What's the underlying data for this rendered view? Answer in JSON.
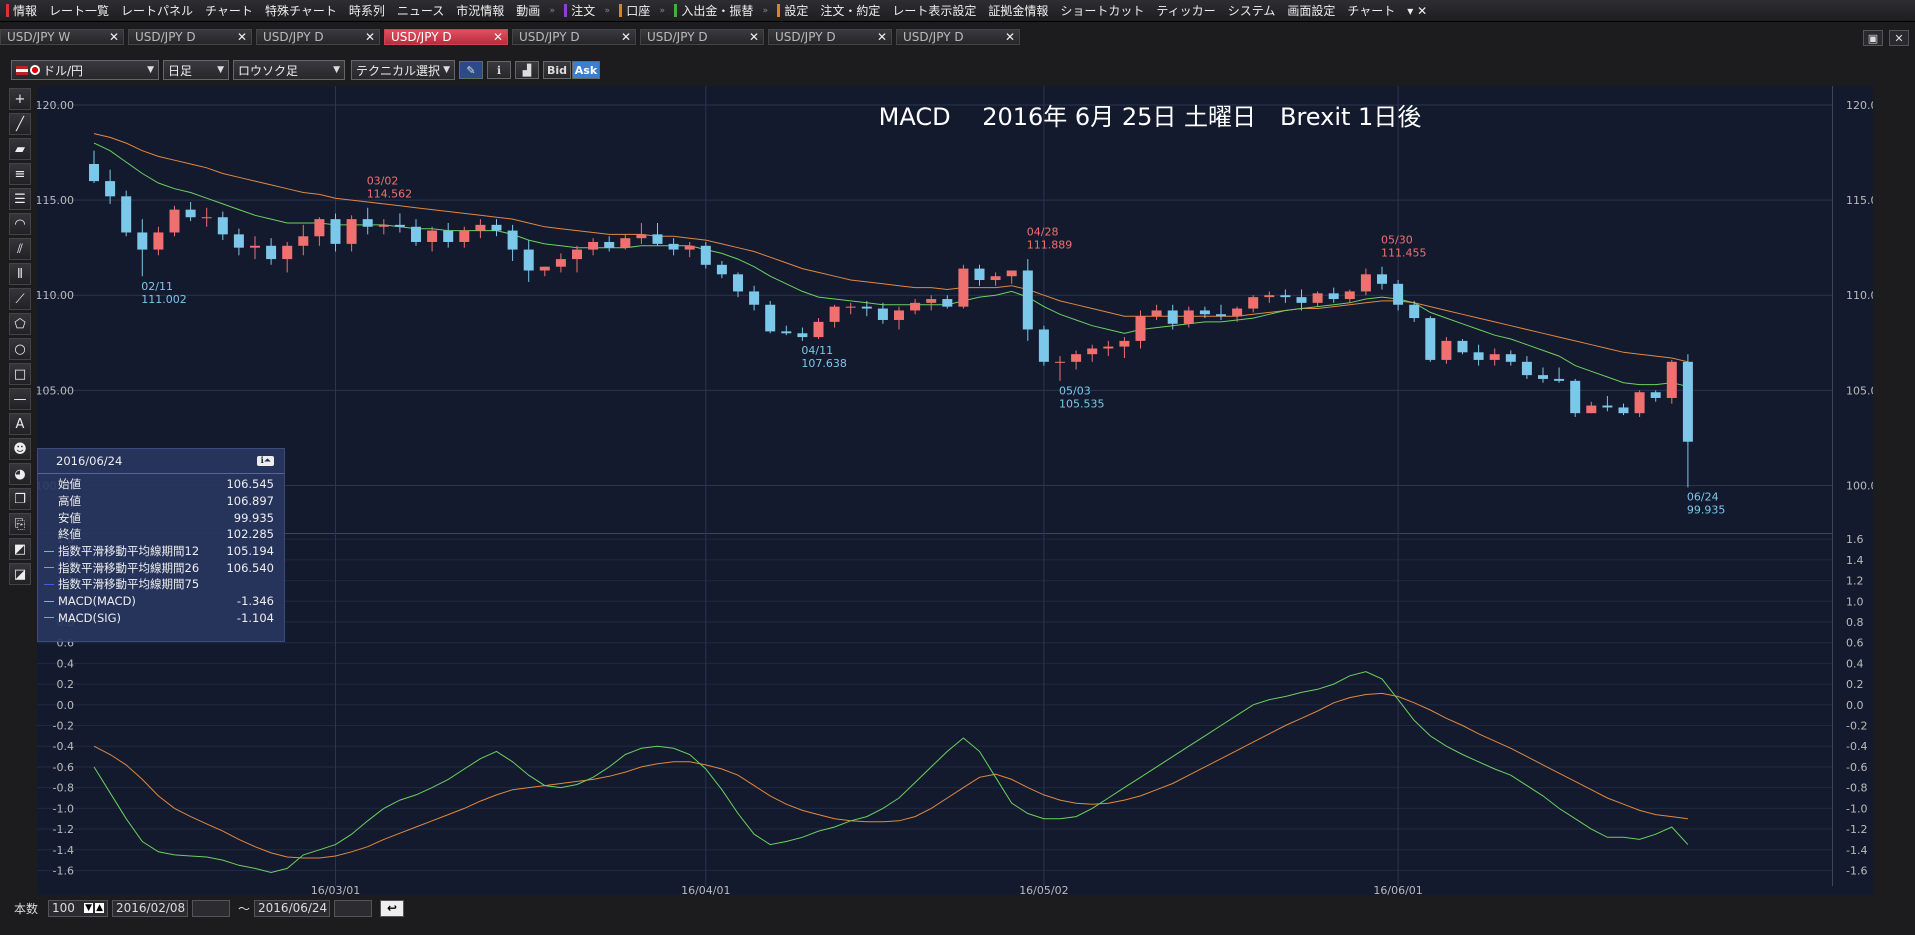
{
  "menu": {
    "items": [
      {
        "label": "情報",
        "color": "#e03030"
      },
      {
        "label": "レート一覧",
        "color": ""
      },
      {
        "label": "レートパネル",
        "color": ""
      },
      {
        "label": "チャート",
        "color": ""
      },
      {
        "label": "特殊チャート",
        "color": ""
      },
      {
        "label": "時系列",
        "color": ""
      },
      {
        "label": "ニュース",
        "color": ""
      },
      {
        "label": "市況情報",
        "color": ""
      },
      {
        "label": "動画",
        "color": ""
      },
      {
        "label": "注文",
        "color": "#9040d0"
      },
      {
        "label": "口座",
        "color": "#e08020"
      },
      {
        "label": "入出金・振替",
        "color": "#40b040"
      },
      {
        "label": "設定",
        "color": "#e08020"
      },
      {
        "label": "注文・約定",
        "color": ""
      },
      {
        "label": "レート表示設定",
        "color": ""
      },
      {
        "label": "証拠金情報",
        "color": ""
      },
      {
        "label": "ショートカット",
        "color": ""
      },
      {
        "label": "ティッカー",
        "color": ""
      },
      {
        "label": "システム",
        "color": ""
      },
      {
        "label": "画面設定",
        "color": ""
      },
      {
        "label": "チャート",
        "color": ""
      }
    ]
  },
  "tabs": [
    {
      "label": "USD/JPY W",
      "active": false
    },
    {
      "label": "USD/JPY D",
      "active": false
    },
    {
      "label": "USD/JPY D",
      "active": false
    },
    {
      "label": "USD/JPY D",
      "active": true
    },
    {
      "label": "USD/JPY D",
      "active": false
    },
    {
      "label": "USD/JPY D",
      "active": false
    },
    {
      "label": "USD/JPY D",
      "active": false
    },
    {
      "label": "USD/JPY D",
      "active": false
    }
  ],
  "toolbar": {
    "pair": "ドル/円",
    "period": "日足",
    "style": "ロウソク足",
    "technical": "テクニカル選択",
    "bid": "Bid",
    "ask": "Ask"
  },
  "chart_title": "MACD　 2016年 6月 25日 土曜日　Brexit 1日後",
  "info": {
    "date": "2016/06/24",
    "rows": [
      {
        "label": "始値",
        "value": "106.545",
        "color": ""
      },
      {
        "label": "高値",
        "value": "106.897",
        "color": ""
      },
      {
        "label": "安値",
        "value": "99.935",
        "color": ""
      },
      {
        "label": "終値",
        "value": "102.285",
        "color": ""
      },
      {
        "label": "指数平滑移動平均線期間12",
        "value": "105.194",
        "color": "#6cd060"
      },
      {
        "label": "指数平滑移動平均線期間26",
        "value": "106.540",
        "color": "#e08840"
      },
      {
        "label": "指数平滑移動平均線期間75",
        "value": "",
        "color": "#4060e0"
      },
      {
        "label": "MACD(MACD)",
        "value": "-1.346",
        "color": "#6cd060"
      },
      {
        "label": "MACD(SIG)",
        "value": "-1.104",
        "color": "#e08840"
      }
    ]
  },
  "bottom": {
    "count_label": "本数",
    "count": "100",
    "from": "2016/02/08",
    "tilde": "〜",
    "to": "2016/06/24"
  },
  "colors": {
    "up": "#f07070",
    "down": "#7cc8ea",
    "ema12": "#6cd060",
    "ema26": "#e08840",
    "bg": "#131a2d",
    "grid": "#2a3550"
  },
  "chart_data": {
    "type": "candlestick",
    "price_axis": {
      "min": 97.5,
      "max": 121,
      "ticks": [
        "120.00",
        "115.00",
        "110.00",
        "105.00",
        "100.00"
      ]
    },
    "macd_axis": {
      "min": -1.75,
      "max": 1.65,
      "ticks": [
        "1.6",
        "1.4",
        "1.2",
        "1.0",
        "0.8",
        "0.6",
        "0.4",
        "0.2",
        "0.0",
        "-0.2",
        "-0.4",
        "-0.6",
        "-0.8",
        "-1.0",
        "-1.2",
        "-1.4",
        "-1.6"
      ]
    },
    "x_labels": [
      {
        "label": "16/03/01",
        "index": 15
      },
      {
        "label": "16/04/01",
        "index": 38
      },
      {
        "label": "16/05/02",
        "index": 59
      },
      {
        "label": "16/06/01",
        "index": 81
      }
    ],
    "annotations": [
      {
        "date": "02/11",
        "value": "111.002",
        "index": 3,
        "price": 111.0,
        "color": "#7cc8ea",
        "pos": "below"
      },
      {
        "date": "03/02",
        "value": "114.562",
        "index": 17,
        "price": 114.56,
        "color": "#f07070",
        "pos": "above"
      },
      {
        "date": "04/11",
        "value": "107.638",
        "index": 44,
        "price": 107.64,
        "color": "#7cc8ea",
        "pos": "below"
      },
      {
        "date": "04/28",
        "value": "111.889",
        "index": 58,
        "price": 111.89,
        "color": "#f07070",
        "pos": "above"
      },
      {
        "date": "05/03",
        "value": "105.535",
        "index": 60,
        "price": 105.53,
        "color": "#7cc8ea",
        "pos": "below"
      },
      {
        "date": "05/30",
        "value": "111.455",
        "index": 80,
        "price": 111.46,
        "color": "#f07070",
        "pos": "above"
      },
      {
        "date": "06/24",
        "value": "99.935",
        "index": 99,
        "price": 99.94,
        "color": "#7cc8ea",
        "pos": "below"
      }
    ],
    "ohlc": [
      [
        116.9,
        117.6,
        115.9,
        116.0
      ],
      [
        116.0,
        116.6,
        114.8,
        115.2
      ],
      [
        115.2,
        115.5,
        113.1,
        113.3
      ],
      [
        113.3,
        114.0,
        111.0,
        112.4
      ],
      [
        112.4,
        113.6,
        112.1,
        113.3
      ],
      [
        113.3,
        114.7,
        113.1,
        114.5
      ],
      [
        114.5,
        114.9,
        113.9,
        114.1
      ],
      [
        114.1,
        114.6,
        113.6,
        114.1
      ],
      [
        114.1,
        114.4,
        112.9,
        113.2
      ],
      [
        113.2,
        113.5,
        112.1,
        112.5
      ],
      [
        112.5,
        113.1,
        111.9,
        112.6
      ],
      [
        112.6,
        113.0,
        111.6,
        111.9
      ],
      [
        111.9,
        112.8,
        111.2,
        112.6
      ],
      [
        112.6,
        113.7,
        112.1,
        113.1
      ],
      [
        113.1,
        114.1,
        112.6,
        114.0
      ],
      [
        114.0,
        114.3,
        112.3,
        112.7
      ],
      [
        112.7,
        114.2,
        112.3,
        114.0
      ],
      [
        114.0,
        114.6,
        113.2,
        113.6
      ],
      [
        113.6,
        114.0,
        113.2,
        113.7
      ],
      [
        113.7,
        114.3,
        113.3,
        113.6
      ],
      [
        113.6,
        114.0,
        112.6,
        112.8
      ],
      [
        112.8,
        113.6,
        112.3,
        113.4
      ],
      [
        113.4,
        113.8,
        112.5,
        112.8
      ],
      [
        112.8,
        113.6,
        112.5,
        113.4
      ],
      [
        113.4,
        114.0,
        113.0,
        113.7
      ],
      [
        113.7,
        114.0,
        113.1,
        113.4
      ],
      [
        113.4,
        113.7,
        111.8,
        112.4
      ],
      [
        112.4,
        112.9,
        110.7,
        111.3
      ],
      [
        111.3,
        111.5,
        111.0,
        111.5
      ],
      [
        111.5,
        112.2,
        111.2,
        111.9
      ],
      [
        111.9,
        112.6,
        111.2,
        112.4
      ],
      [
        112.4,
        113.0,
        112.1,
        112.8
      ],
      [
        112.8,
        113.1,
        112.3,
        112.5
      ],
      [
        112.5,
        113.2,
        112.4,
        113.0
      ],
      [
        113.0,
        113.8,
        112.7,
        113.2
      ],
      [
        113.2,
        113.8,
        112.6,
        112.7
      ],
      [
        112.7,
        113.0,
        112.1,
        112.4
      ],
      [
        112.4,
        112.8,
        112.0,
        112.6
      ],
      [
        112.6,
        112.8,
        111.4,
        111.6
      ],
      [
        111.6,
        111.8,
        110.9,
        111.1
      ],
      [
        111.1,
        111.2,
        109.9,
        110.2
      ],
      [
        110.2,
        110.5,
        109.2,
        109.5
      ],
      [
        109.5,
        109.7,
        108.0,
        108.1
      ],
      [
        108.1,
        108.4,
        107.9,
        108.0
      ],
      [
        108.0,
        108.3,
        107.6,
        107.8
      ],
      [
        107.8,
        108.8,
        107.7,
        108.6
      ],
      [
        108.6,
        109.5,
        108.3,
        109.4
      ],
      [
        109.4,
        109.6,
        109.0,
        109.4
      ],
      [
        109.4,
        109.7,
        108.9,
        109.3
      ],
      [
        109.3,
        109.6,
        108.5,
        108.7
      ],
      [
        108.7,
        109.4,
        108.2,
        109.2
      ],
      [
        109.2,
        109.8,
        109.0,
        109.6
      ],
      [
        109.6,
        110.0,
        109.2,
        109.8
      ],
      [
        109.8,
        110.0,
        109.3,
        109.4
      ],
      [
        109.4,
        111.6,
        109.3,
        111.4
      ],
      [
        111.4,
        111.6,
        110.5,
        110.8
      ],
      [
        110.8,
        111.2,
        110.5,
        111.0
      ],
      [
        111.0,
        111.3,
        110.6,
        111.3
      ],
      [
        111.3,
        111.9,
        107.6,
        108.2
      ],
      [
        108.2,
        108.4,
        106.3,
        106.5
      ],
      [
        106.5,
        106.8,
        105.5,
        106.5
      ],
      [
        106.5,
        107.1,
        106.1,
        106.9
      ],
      [
        106.9,
        107.4,
        106.5,
        107.2
      ],
      [
        107.2,
        107.6,
        106.8,
        107.3
      ],
      [
        107.3,
        107.8,
        106.7,
        107.6
      ],
      [
        107.6,
        109.2,
        107.2,
        108.9
      ],
      [
        108.9,
        109.5,
        108.7,
        109.2
      ],
      [
        109.2,
        109.5,
        108.2,
        108.5
      ],
      [
        108.5,
        109.4,
        108.3,
        109.2
      ],
      [
        109.2,
        109.4,
        108.8,
        109.0
      ],
      [
        109.0,
        109.5,
        108.7,
        108.9
      ],
      [
        108.9,
        109.4,
        108.6,
        109.3
      ],
      [
        109.3,
        110.0,
        109.1,
        109.9
      ],
      [
        109.9,
        110.2,
        109.6,
        110.0
      ],
      [
        110.0,
        110.3,
        109.6,
        109.9
      ],
      [
        109.9,
        110.3,
        109.2,
        109.6
      ],
      [
        109.6,
        110.2,
        109.4,
        110.1
      ],
      [
        110.1,
        110.4,
        109.6,
        109.8
      ],
      [
        109.8,
        110.3,
        109.6,
        110.2
      ],
      [
        110.2,
        111.4,
        110.0,
        111.1
      ],
      [
        111.1,
        111.5,
        110.3,
        110.6
      ],
      [
        110.6,
        110.8,
        109.2,
        109.5
      ],
      [
        109.5,
        109.7,
        108.6,
        108.8
      ],
      [
        108.8,
        108.9,
        106.5,
        106.6
      ],
      [
        106.6,
        107.8,
        106.4,
        107.6
      ],
      [
        107.6,
        107.7,
        106.9,
        107.0
      ],
      [
        107.0,
        107.4,
        106.3,
        106.6
      ],
      [
        106.6,
        107.2,
        106.3,
        106.9
      ],
      [
        106.9,
        107.1,
        106.3,
        106.5
      ],
      [
        106.5,
        106.8,
        105.6,
        105.8
      ],
      [
        105.8,
        106.2,
        105.4,
        105.6
      ],
      [
        105.6,
        106.2,
        105.4,
        105.5
      ],
      [
        105.5,
        105.6,
        103.6,
        103.8
      ],
      [
        103.8,
        104.4,
        103.8,
        104.2
      ],
      [
        104.2,
        104.7,
        103.9,
        104.1
      ],
      [
        104.1,
        104.3,
        103.7,
        103.8
      ],
      [
        103.8,
        105.0,
        103.6,
        104.9
      ],
      [
        104.9,
        105.0,
        104.4,
        104.6
      ],
      [
        104.6,
        106.6,
        104.3,
        106.5
      ],
      [
        106.5,
        106.9,
        99.9,
        102.3
      ]
    ],
    "ema12": [
      118.0,
      117.6,
      117.0,
      116.4,
      115.9,
      115.6,
      115.4,
      115.1,
      114.8,
      114.5,
      114.2,
      114.0,
      113.8,
      113.8,
      113.8,
      113.7,
      113.7,
      113.7,
      113.7,
      113.6,
      113.5,
      113.5,
      113.4,
      113.4,
      113.4,
      113.4,
      113.2,
      112.9,
      112.7,
      112.6,
      112.5,
      112.5,
      112.5,
      112.5,
      112.6,
      112.6,
      112.6,
      112.6,
      112.4,
      112.2,
      111.9,
      111.5,
      111.0,
      110.6,
      110.2,
      109.9,
      109.8,
      109.7,
      109.6,
      109.5,
      109.5,
      109.5,
      109.5,
      109.5,
      109.7,
      109.9,
      110.0,
      110.2,
      109.9,
      109.4,
      109.0,
      108.7,
      108.4,
      108.2,
      108.0,
      108.2,
      108.3,
      108.4,
      108.5,
      108.6,
      108.6,
      108.7,
      108.8,
      109.0,
      109.2,
      109.3,
      109.4,
      109.5,
      109.6,
      109.8,
      109.9,
      109.8,
      109.6,
      109.1,
      108.8,
      108.5,
      108.2,
      107.9,
      107.7,
      107.4,
      107.1,
      106.8,
      106.3,
      106.0,
      105.7,
      105.4,
      105.3,
      105.3,
      105.4,
      105.2
    ],
    "ema26": [
      118.5,
      118.3,
      118.0,
      117.6,
      117.3,
      117.1,
      116.9,
      116.7,
      116.4,
      116.2,
      116.0,
      115.8,
      115.6,
      115.4,
      115.3,
      115.1,
      115.0,
      114.9,
      114.8,
      114.7,
      114.6,
      114.5,
      114.4,
      114.3,
      114.2,
      114.1,
      114.0,
      113.8,
      113.6,
      113.5,
      113.4,
      113.3,
      113.2,
      113.2,
      113.2,
      113.1,
      113.1,
      113.0,
      112.9,
      112.7,
      112.5,
      112.3,
      112.0,
      111.7,
      111.4,
      111.2,
      111.0,
      110.8,
      110.7,
      110.6,
      110.5,
      110.4,
      110.4,
      110.3,
      110.4,
      110.4,
      110.4,
      110.5,
      110.3,
      110.0,
      109.7,
      109.5,
      109.3,
      109.1,
      108.9,
      108.9,
      108.9,
      108.9,
      108.9,
      108.9,
      108.9,
      108.9,
      109.0,
      109.1,
      109.2,
      109.3,
      109.3,
      109.4,
      109.5,
      109.6,
      109.7,
      109.7,
      109.6,
      109.4,
      109.2,
      109.0,
      108.8,
      108.6,
      108.4,
      108.2,
      108.0,
      107.8,
      107.6,
      107.4,
      107.2,
      107.0,
      106.9,
      106.8,
      106.7,
      106.5
    ],
    "macd": [
      -0.6,
      -0.85,
      -1.1,
      -1.32,
      -1.42,
      -1.45,
      -1.46,
      -1.47,
      -1.5,
      -1.55,
      -1.58,
      -1.62,
      -1.58,
      -1.45,
      -1.4,
      -1.35,
      -1.25,
      -1.12,
      -1.0,
      -0.92,
      -0.87,
      -0.8,
      -0.72,
      -0.62,
      -0.52,
      -0.45,
      -0.55,
      -0.68,
      -0.78,
      -0.8,
      -0.77,
      -0.7,
      -0.6,
      -0.48,
      -0.42,
      -0.4,
      -0.42,
      -0.48,
      -0.62,
      -0.82,
      -1.05,
      -1.25,
      -1.35,
      -1.32,
      -1.28,
      -1.22,
      -1.18,
      -1.12,
      -1.08,
      -1.0,
      -0.9,
      -0.75,
      -0.6,
      -0.45,
      -0.32,
      -0.45,
      -0.7,
      -0.95,
      -1.05,
      -1.1,
      -1.1,
      -1.08,
      -1.0,
      -0.9,
      -0.8,
      -0.7,
      -0.6,
      -0.5,
      -0.4,
      -0.3,
      -0.2,
      -0.1,
      0.0,
      0.05,
      0.08,
      0.12,
      0.15,
      0.2,
      0.28,
      0.32,
      0.25,
      0.05,
      -0.15,
      -0.3,
      -0.4,
      -0.48,
      -0.55,
      -0.62,
      -0.68,
      -0.78,
      -0.88,
      -1.0,
      -1.1,
      -1.2,
      -1.28,
      -1.28,
      -1.3,
      -1.25,
      -1.18,
      -1.35
    ],
    "signal": [
      -0.4,
      -0.48,
      -0.58,
      -0.72,
      -0.88,
      -1.0,
      -1.08,
      -1.15,
      -1.22,
      -1.3,
      -1.37,
      -1.43,
      -1.47,
      -1.48,
      -1.48,
      -1.46,
      -1.42,
      -1.37,
      -1.3,
      -1.24,
      -1.18,
      -1.12,
      -1.06,
      -1.0,
      -0.93,
      -0.87,
      -0.82,
      -0.8,
      -0.78,
      -0.76,
      -0.74,
      -0.72,
      -0.69,
      -0.65,
      -0.6,
      -0.57,
      -0.55,
      -0.55,
      -0.58,
      -0.62,
      -0.68,
      -0.78,
      -0.88,
      -0.96,
      -1.02,
      -1.06,
      -1.1,
      -1.12,
      -1.13,
      -1.13,
      -1.12,
      -1.08,
      -1.0,
      -0.9,
      -0.8,
      -0.7,
      -0.67,
      -0.72,
      -0.8,
      -0.87,
      -0.92,
      -0.95,
      -0.96,
      -0.95,
      -0.92,
      -0.88,
      -0.82,
      -0.76,
      -0.68,
      -0.6,
      -0.52,
      -0.44,
      -0.36,
      -0.28,
      -0.2,
      -0.13,
      -0.06,
      0.02,
      0.07,
      0.1,
      0.11,
      0.08,
      0.02,
      -0.05,
      -0.13,
      -0.2,
      -0.28,
      -0.35,
      -0.42,
      -0.5,
      -0.58,
      -0.66,
      -0.74,
      -0.82,
      -0.9,
      -0.96,
      -1.02,
      -1.06,
      -1.08,
      -1.1
    ]
  }
}
